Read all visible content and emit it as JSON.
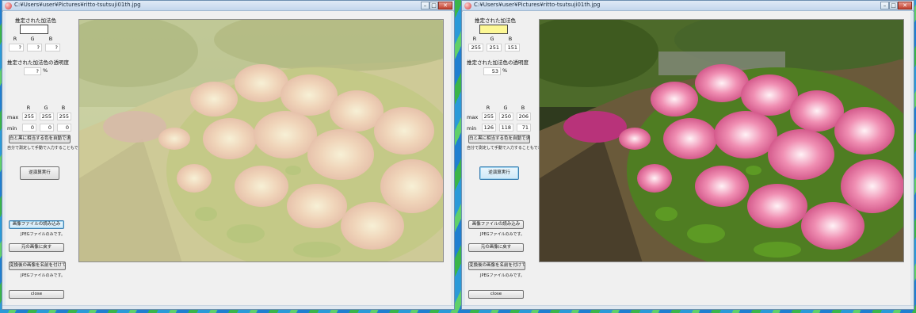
{
  "windows": [
    {
      "title": "C:¥Users¥user¥Pictures¥ritto-tsutsuji01th.jpg",
      "swatch_color": "#ffffff",
      "rgb_values": [
        "?",
        "?",
        "?"
      ],
      "opacity_value": "?",
      "max_values": [
        "255",
        "255",
        "255"
      ],
      "min_values": [
        "0",
        "0",
        "0"
      ]
    },
    {
      "title": "C:¥Users¥user¥Pictures¥ritto-tsutsuji01th.jpg",
      "swatch_color": "#fdf895",
      "rgb_values": [
        "255",
        "251",
        "151"
      ],
      "opacity_value": "53",
      "max_values": [
        "255",
        "250",
        "206"
      ],
      "min_values": [
        "126",
        "118",
        "71"
      ]
    }
  ],
  "labels": {
    "estimated_color": "推定された加法色",
    "r": "R",
    "g": "G",
    "b": "B",
    "estimated_opacity": "推定された加法色の透明度",
    "percent": "%",
    "max": "max",
    "min": "min",
    "auto_button": "白と黒に相当する色を自動で求める",
    "manual_note": "自分で測定して手動で入力することもできます。",
    "run_button": "逆演算実行",
    "load_button": "画像ファイルの読み込み",
    "jpeg_only": "JPEGファイルのみです。",
    "restore_button": "元の画像に戻す",
    "save_button": "変換後の画像を名前を付けて保存",
    "close_button": "close"
  },
  "colors": {
    "titlebar": "#c3d6ec",
    "window_bg": "#f0f0f0",
    "focus_border": "#3c7fb1"
  }
}
